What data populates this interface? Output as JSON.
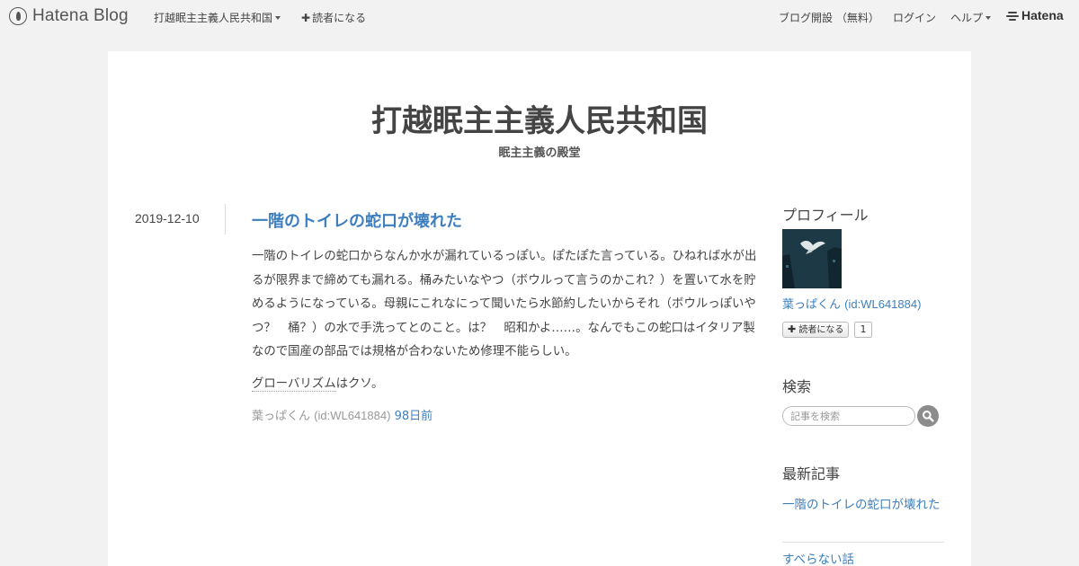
{
  "global_header": {
    "logo_text": "Hatena Blog",
    "blog_menu_label": "打越眠主主義人民共和国",
    "subscribe_label": "読者になる",
    "open_blog_label": "ブログ開設 （無料）",
    "login_label": "ログイン",
    "help_label": "ヘルプ",
    "hatena_label": "Hatena"
  },
  "blog": {
    "title": "打越眠主主義人民共和国",
    "description": "眠主主義の殿堂"
  },
  "entry": {
    "date": "2019-12-10",
    "title": "一階のトイレの蛇口が壊れた",
    "paragraph1": "一階のトイレの蛇口からなんか水が漏れているっぽい。ぽたぽた言っている。ひねれば水が出るが限界まで締めても漏れる。桶みたいなやつ（ボウルって言うのかこれ？）を置いて水を貯めるようになっている。母親にこれなにって聞いたら水節約したいからそれ（ボウルっぽいやつ？　桶？）の水で手洗ってとのこと。は？　昭和かよ……。なんでもこの蛇口はイタリア製なので国産の部品では規格が合わないため修理不能らしい。",
    "keyword": "グローバリズム",
    "paragraph2_rest": "はクソ。",
    "author": "葉っぱくん",
    "author_id": "(id:WL641884)",
    "time_ago": "98日前"
  },
  "sidebar": {
    "profile": {
      "title": "プロフィール",
      "name": "葉っぱくん",
      "id": "(id:WL641884)",
      "subscribe_label": "読者になる",
      "subscriber_count": "1"
    },
    "search": {
      "title": "検索",
      "placeholder": "記事を検索"
    },
    "recent": {
      "title": "最新記事",
      "items": [
        "一階のトイレの蛇口が壊れた",
        "すべらない話"
      ]
    }
  },
  "colors": {
    "link": "#3d7fbe",
    "background": "#f2f2f2",
    "text": "#444444"
  }
}
